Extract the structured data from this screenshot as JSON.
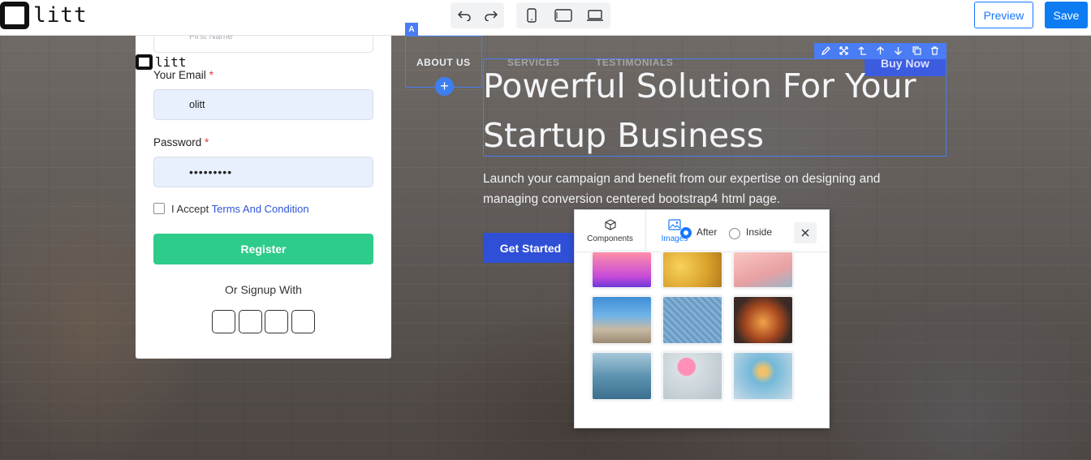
{
  "topbar": {
    "logo_text": "litt",
    "preview_label": "Preview",
    "save_label": "Save"
  },
  "hero": {
    "nav": {
      "about": "ABOUT US",
      "services": "SERVICES",
      "testimonials": "TESTIMONIALS"
    },
    "selection_tag": "A",
    "buy_label": "Buy Now",
    "title": "Powerful Solution For Your Startup Business",
    "subtitle": "Launch your campaign and benefit from our expertise on designing and managing conversion centered bootstrap4 html page.",
    "cta_label": "Get Started"
  },
  "form": {
    "first_name_placeholder": "First Name",
    "logo_text": "litt",
    "email_label": "Your Email",
    "email_value": "olitt",
    "password_label": "Password",
    "password_value": "•••••••••",
    "required_mark": "*",
    "accept_prefix": "I Accept",
    "accept_link": "Terms And Condition",
    "register_label": "Register",
    "or_signup": "Or Signup With"
  },
  "panel": {
    "tabs": {
      "components": "Components",
      "images": "Images"
    },
    "placement": {
      "after": "After",
      "inside": "Inside",
      "selected": "After"
    }
  },
  "colors": {
    "accent": "#1677ff",
    "selection": "#4a7cf3",
    "register": "#2ecc8a",
    "cta": "#2f4fd6"
  }
}
